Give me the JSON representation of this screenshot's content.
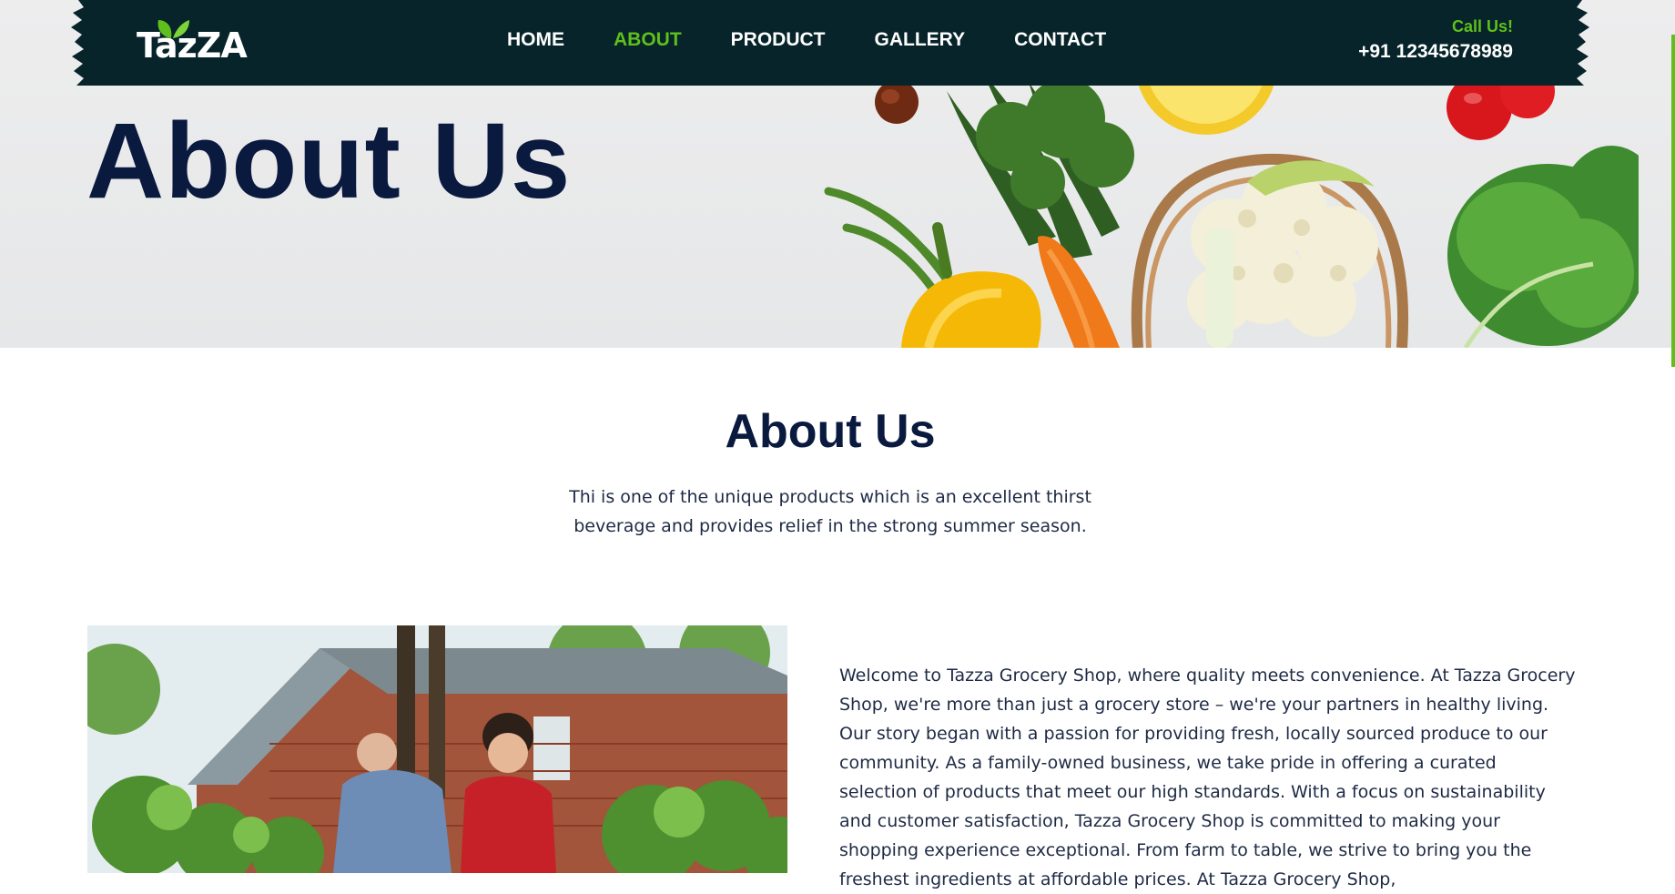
{
  "brand": {
    "logo_text": "TazZA"
  },
  "nav": {
    "items": [
      {
        "label": "HOME",
        "active": false
      },
      {
        "label": "ABOUT",
        "active": true
      },
      {
        "label": "PRODUCT",
        "active": false
      },
      {
        "label": "GALLERY",
        "active": false
      },
      {
        "label": "CONTACT",
        "active": false
      }
    ]
  },
  "contact": {
    "call_label": "Call Us!",
    "phone": "+91 12345678989"
  },
  "hero": {
    "title": "About Us"
  },
  "about": {
    "title": "About Us",
    "subtitle": "Thi is one of the unique products which is an excellent thirst beverage and provides relief in the strong summer season.",
    "body": "Welcome to Tazza Grocery Shop, where quality meets convenience. At Tazza Grocery Shop, we're more than just a grocery store – we're your partners in healthy living. Our story began with a passion for providing fresh, locally sourced produce to our community. As a family-owned business, we take pride in offering a curated selection of products that meet our high standards. With a focus on sustainability and customer satisfaction, Tazza Grocery Shop is committed to making your shopping experience exceptional. From farm to table, we strive to bring you the freshest ingredients at affordable prices. At Tazza Grocery Shop,"
  },
  "colors": {
    "nav_bg": "#06242a",
    "accent": "#5fbf1c",
    "heading": "#0a1a3f"
  },
  "icons": {
    "logo_leaf": "leaf-icon",
    "hero_art": "vegetables-illustration",
    "about_photo": "gardening-photo"
  }
}
